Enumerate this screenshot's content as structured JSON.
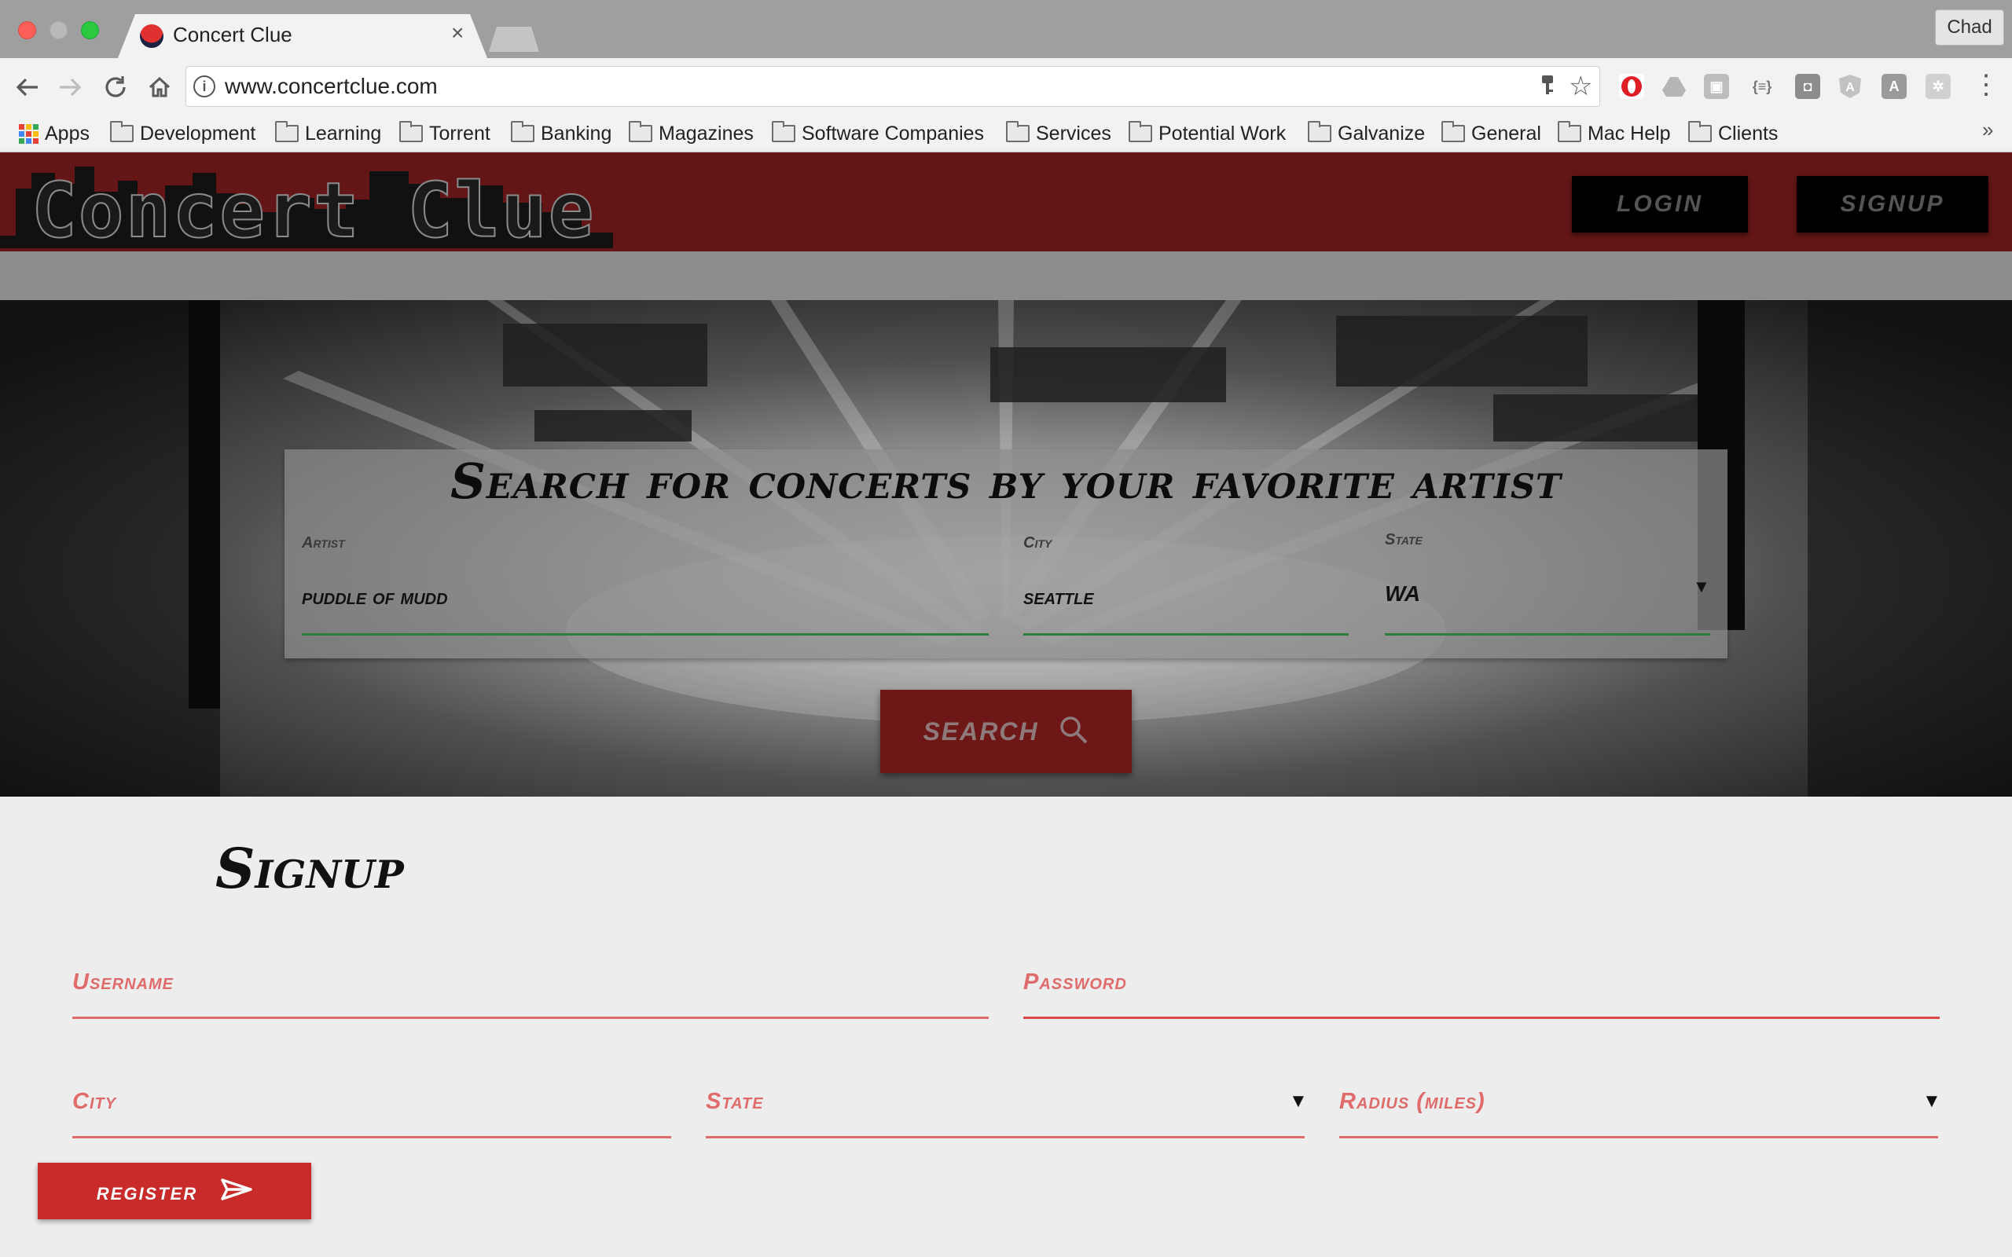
{
  "browser": {
    "tab_title": "Concert Clue",
    "tab_close": "×",
    "profile_name": "Chad",
    "url": "www.concertclue.com",
    "bookmarks_more": "»",
    "bookmarks": [
      {
        "label": "Apps",
        "icon": "apps-grid-icon"
      },
      {
        "label": "Development",
        "icon": "folder-icon"
      },
      {
        "label": "Learning",
        "icon": "folder-icon"
      },
      {
        "label": "Torrent",
        "icon": "folder-icon"
      },
      {
        "label": "Banking",
        "icon": "folder-icon"
      },
      {
        "label": "Magazines",
        "icon": "folder-icon"
      },
      {
        "label": "Software Companies",
        "icon": "folder-icon"
      },
      {
        "label": "Services",
        "icon": "folder-icon"
      },
      {
        "label": "Potential Work",
        "icon": "folder-icon"
      },
      {
        "label": "Galvanize",
        "icon": "folder-icon"
      },
      {
        "label": "General",
        "icon": "folder-icon"
      },
      {
        "label": "Mac Help",
        "icon": "folder-icon"
      },
      {
        "label": "Clients",
        "icon": "folder-icon"
      }
    ]
  },
  "header": {
    "logo_text": "Concert Clue",
    "login_label": "LOGIN",
    "signup_label": "SIGNUP",
    "brand_color": "#641616"
  },
  "search": {
    "title": "Search for concerts by your favorite artist",
    "artist_label": "Artist",
    "artist_value": "puddle of mudd",
    "city_label": "City",
    "city_value": "seattle",
    "state_label": "State",
    "state_value": "WA",
    "button_label": "SEARCH"
  },
  "signup": {
    "heading": "Signup",
    "username_label": "Username",
    "password_label": "Password",
    "city_label": "City",
    "state_label": "State",
    "radius_label": "Radius (miles)",
    "register_label": "register",
    "accent_color": "#e06b6b"
  }
}
